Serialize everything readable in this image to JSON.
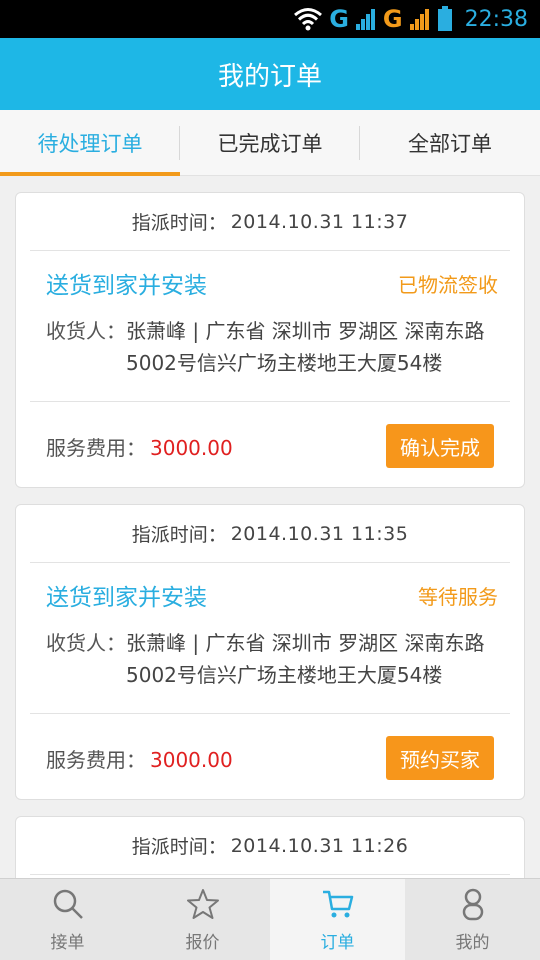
{
  "status_bar": {
    "network_1": "G",
    "network_2": "G",
    "time": "22:38",
    "icons": [
      "wifi-icon",
      "signal-icon",
      "signal-icon",
      "battery-icon"
    ]
  },
  "header": {
    "title": "我的订单"
  },
  "tabs": [
    {
      "label": "待处理订单",
      "active": true
    },
    {
      "label": "已完成订单",
      "active": false
    },
    {
      "label": "全部订单",
      "active": false
    }
  ],
  "orders": [
    {
      "time_label": "指派时间：",
      "time_value": "2014.10.31  11:37",
      "service": "送货到家并安装",
      "status": "已物流签收",
      "receiver_label": "收货人：",
      "receiver_text": "张萧峰 | 广东省 深圳市 罗湖区 深南东路5002号信兴广场主楼地王大厦54楼",
      "fee_label": "服务费用：",
      "fee_value": "3000.00",
      "action_label": "确认完成"
    },
    {
      "time_label": "指派时间：",
      "time_value": "2014.10.31  11:35",
      "service": "送货到家并安装",
      "status": "等待服务",
      "receiver_label": "收货人：",
      "receiver_text": "张萧峰 | 广东省 深圳市 罗湖区 深南东路5002号信兴广场主楼地王大厦54楼",
      "fee_label": "服务费用：",
      "fee_value": "3000.00",
      "action_label": "预约买家"
    },
    {
      "time_label": "指派时间：",
      "time_value": "2014.10.31  11:26"
    }
  ],
  "bottom_nav": [
    {
      "label": "接单",
      "icon": "search-icon",
      "active": false
    },
    {
      "label": "报价",
      "icon": "star-icon",
      "active": false
    },
    {
      "label": "订单",
      "icon": "cart-icon",
      "active": true
    },
    {
      "label": "我的",
      "icon": "user-icon",
      "active": false
    }
  ],
  "colors": {
    "header_bg": "#1eb7e6",
    "accent_blue": "#2aaee0",
    "accent_orange": "#f7961b",
    "fee_red": "#e02020"
  }
}
